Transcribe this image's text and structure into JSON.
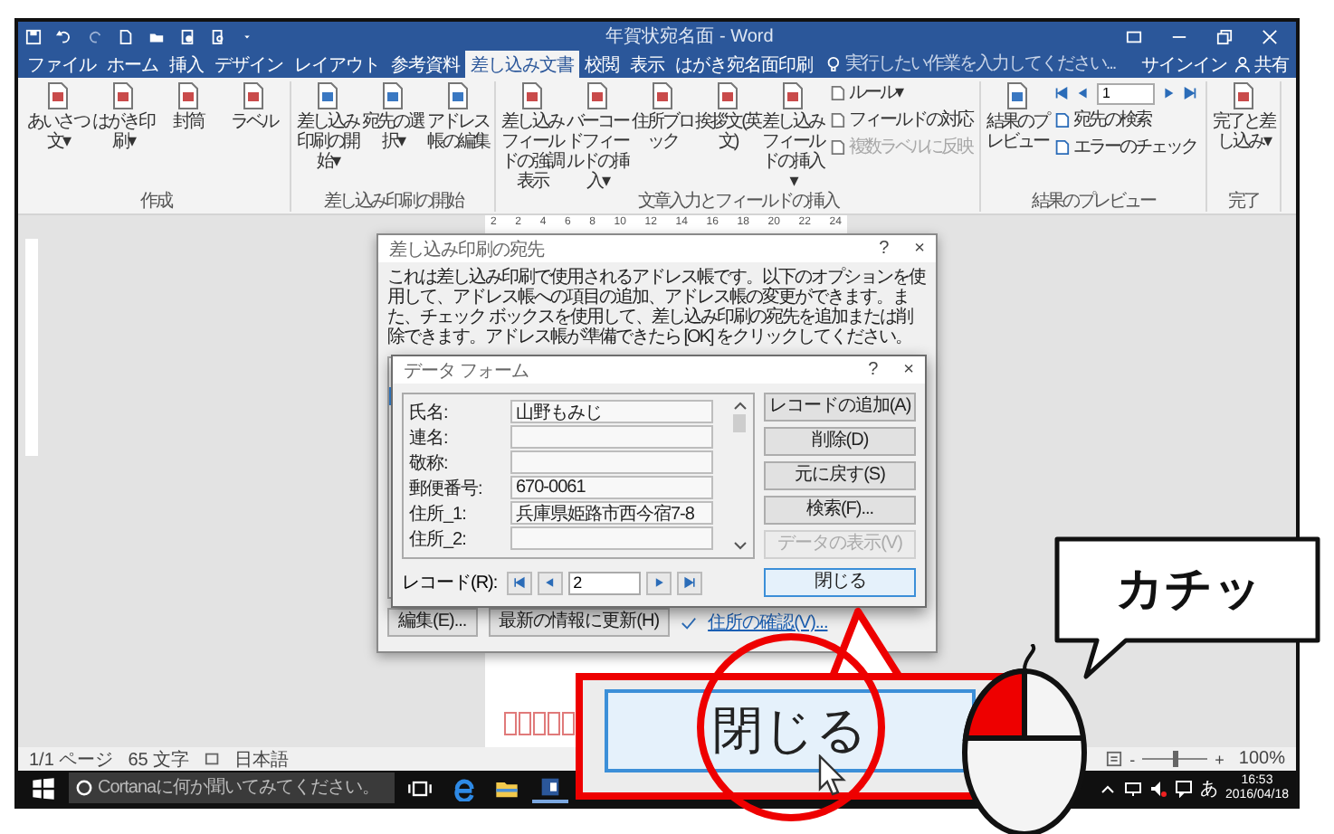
{
  "window": {
    "title": "年賀状宛名面 - Word"
  },
  "tabs": [
    {
      "label": "ファイル",
      "selected": false
    },
    {
      "label": "ホーム",
      "selected": false
    },
    {
      "label": "挿入",
      "selected": false
    },
    {
      "label": "デザイン",
      "selected": false
    },
    {
      "label": "レイアウト",
      "selected": false
    },
    {
      "label": "参考資料",
      "selected": false
    },
    {
      "label": "差し込み文書",
      "selected": true
    },
    {
      "label": "校閲",
      "selected": false
    },
    {
      "label": "表示",
      "selected": false
    },
    {
      "label": "はがき宛名面印刷",
      "selected": false
    }
  ],
  "tell_me": {
    "placeholder": "実行したい作業を入力してください..."
  },
  "account": {
    "sign_in": "サインイン",
    "share": "共有"
  },
  "ribbon": {
    "groups": [
      {
        "label": "作成",
        "items": [
          {
            "kind": "large",
            "label": "あいさつ文▾"
          },
          {
            "kind": "large",
            "label": "はがき印刷▾"
          },
          {
            "kind": "large",
            "label": "封筒"
          },
          {
            "kind": "large",
            "label": "ラベル"
          }
        ]
      },
      {
        "label": "差し込み印刷の開始",
        "items": [
          {
            "kind": "large",
            "label": "差し込み印刷の開始▾"
          },
          {
            "kind": "large",
            "label": "宛先の選択▾"
          },
          {
            "kind": "large",
            "label": "アドレス帳の編集"
          }
        ]
      },
      {
        "label": "文章入力とフィールドの挿入",
        "items": [
          {
            "kind": "large",
            "label": "差し込みフィールドの強調表示"
          },
          {
            "kind": "large",
            "label": "バーコードフィールドの挿入▾"
          },
          {
            "kind": "large",
            "label": "住所ブロック"
          },
          {
            "kind": "large",
            "label": "挨拶文(英文)"
          },
          {
            "kind": "large",
            "label": "差し込みフィールドの挿入▾"
          },
          {
            "kind": "stack",
            "items": [
              {
                "label": "ルール▾",
                "disabled": false
              },
              {
                "label": "フィールドの対応",
                "disabled": false
              },
              {
                "label": "複数ラベルに反映",
                "disabled": true
              }
            ]
          }
        ]
      },
      {
        "label": "結果のプレビュー",
        "items": [
          {
            "kind": "large",
            "label": "結果のプレビュー"
          },
          {
            "kind": "nav",
            "record": "1",
            "items": [
              {
                "label": "宛先の検索",
                "disabled": false
              },
              {
                "label": "エラーのチェック",
                "disabled": false
              }
            ]
          }
        ]
      },
      {
        "label": "完了",
        "items": [
          {
            "kind": "large",
            "label": "完了と差し込み▾"
          }
        ]
      }
    ]
  },
  "ruler": [
    "2",
    "2",
    "4",
    "6",
    "8",
    "10",
    "12",
    "14",
    "16",
    "18",
    "20",
    "22",
    "24"
  ],
  "recipients_dialog": {
    "title": "差し込み印刷の宛先",
    "help": "?",
    "close": "×",
    "description": "これは差し込み印刷で使用されるアドレス帳です。以下のオプションを使用して、アドレス帳への項目の追加、アドレス帳の変更ができます。また、チェック ボックスを使用して、差し込み印刷の宛先を追加または削除できます。アドレス帳が準備できたら [OK] をクリックしてください。",
    "buttons": [
      "編集(E)...",
      "最新の情報に更新(H)"
    ],
    "link": "住所の確認(V)..."
  },
  "data_form": {
    "title": "データ フォーム",
    "help": "?",
    "close": "×",
    "fields": [
      {
        "label": "氏名:",
        "value": "山野もみじ"
      },
      {
        "label": "連名:"
      },
      {
        "label": "敬称:"
      },
      {
        "label": "郵便番号:",
        "value": "670-0061"
      },
      {
        "label": "住所_1:",
        "value": "兵庫県姫路市西今宿7-8"
      },
      {
        "label": "住所_2:"
      }
    ],
    "buttons": [
      {
        "label": "レコードの追加(A)",
        "disabled": false
      },
      {
        "label": "削除(D)",
        "disabled": false
      },
      {
        "label": "元に戻す(S)",
        "disabled": false
      },
      {
        "label": "検索(F)...",
        "disabled": false
      },
      {
        "label": "データの表示(V)",
        "disabled": true
      }
    ],
    "record_label": "レコード(R):",
    "record": "2",
    "close_button": "閉じる"
  },
  "status_bar": {
    "page": "1/1 ページ",
    "words": "65 文字",
    "language": "日本語",
    "zoom_out": "-",
    "zoom_slider": {
      "level": 0.5
    },
    "zoom_in": "+",
    "zoom": "100%"
  },
  "taskbar": {
    "search": {
      "placeholder": "Cortanaに何か聞いてみてください。"
    },
    "ime": "あ",
    "time": "16:53",
    "date": "2016/04/18"
  },
  "callout": {
    "zoomed_button": "閉じる",
    "speech": "カチッ"
  }
}
